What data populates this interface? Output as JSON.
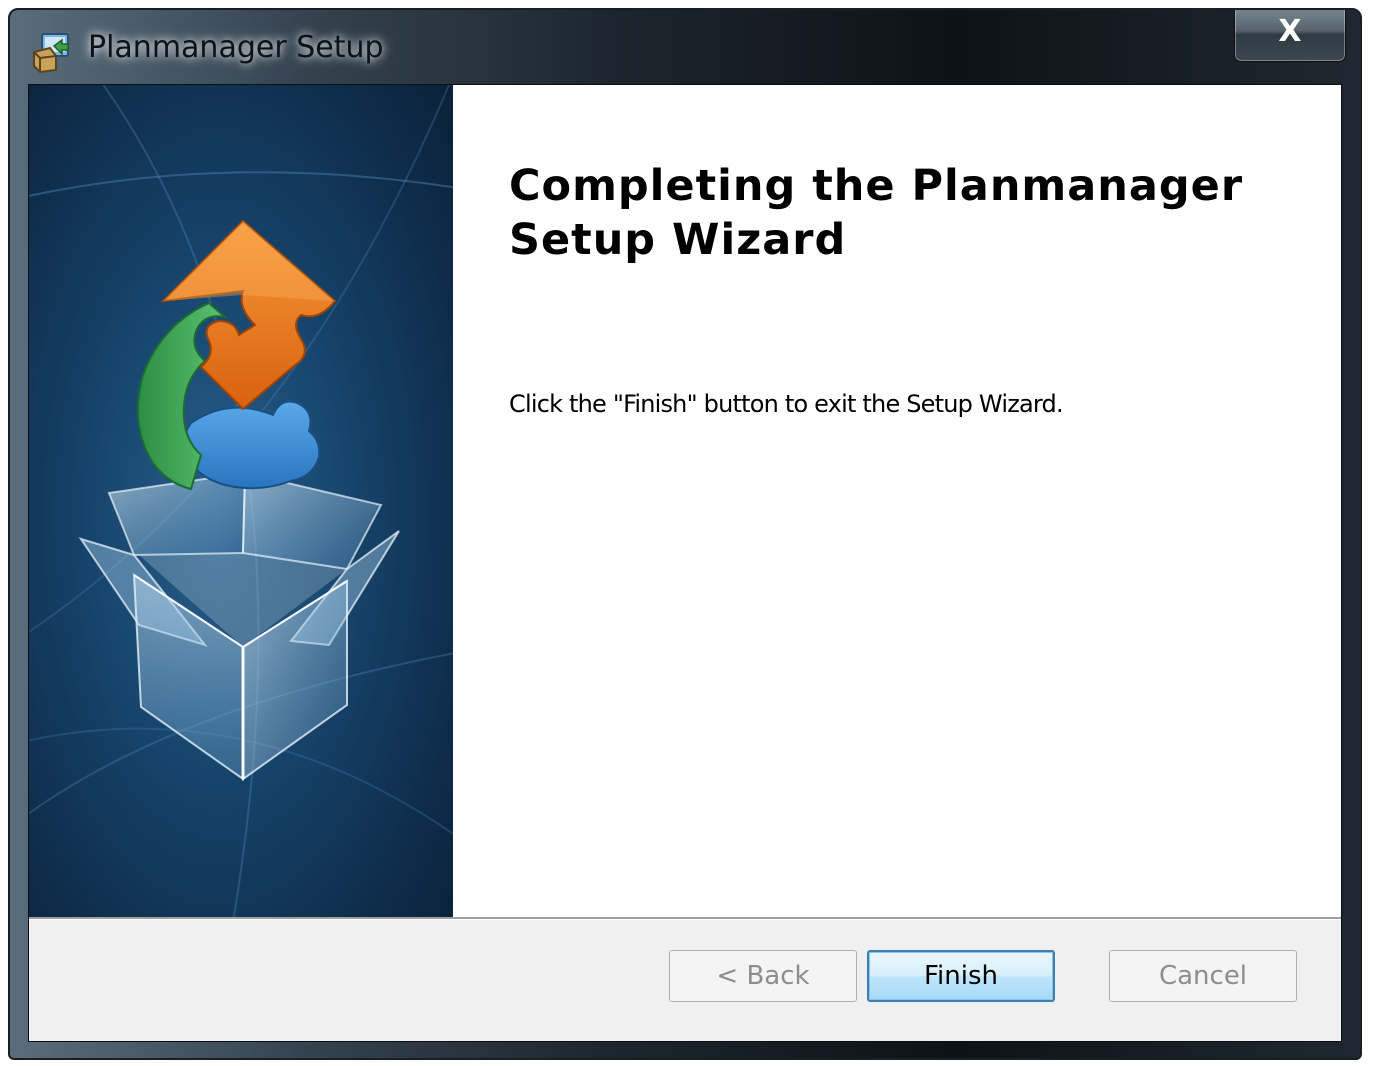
{
  "window": {
    "title": "Planmanager Setup",
    "close_label": "X",
    "app_icon": "installer-icon"
  },
  "banner": {
    "graphic": "open-box-with-puzzle-pieces-illustration",
    "colors": {
      "background_dark": "#0b2036",
      "background_light": "#1f5d8e",
      "puzzle_orange": "#ee7a1c",
      "puzzle_green": "#2f9b4c",
      "puzzle_blue": "#3d8fd6"
    }
  },
  "content": {
    "heading": "Completing the Planmanager Setup Wizard",
    "message": "Click the \"Finish\" button to exit the Setup Wizard."
  },
  "footer": {
    "back_label": "< Back",
    "back_enabled": false,
    "finish_label": "Finish",
    "finish_is_default": true,
    "cancel_label": "Cancel",
    "cancel_enabled": false
  }
}
